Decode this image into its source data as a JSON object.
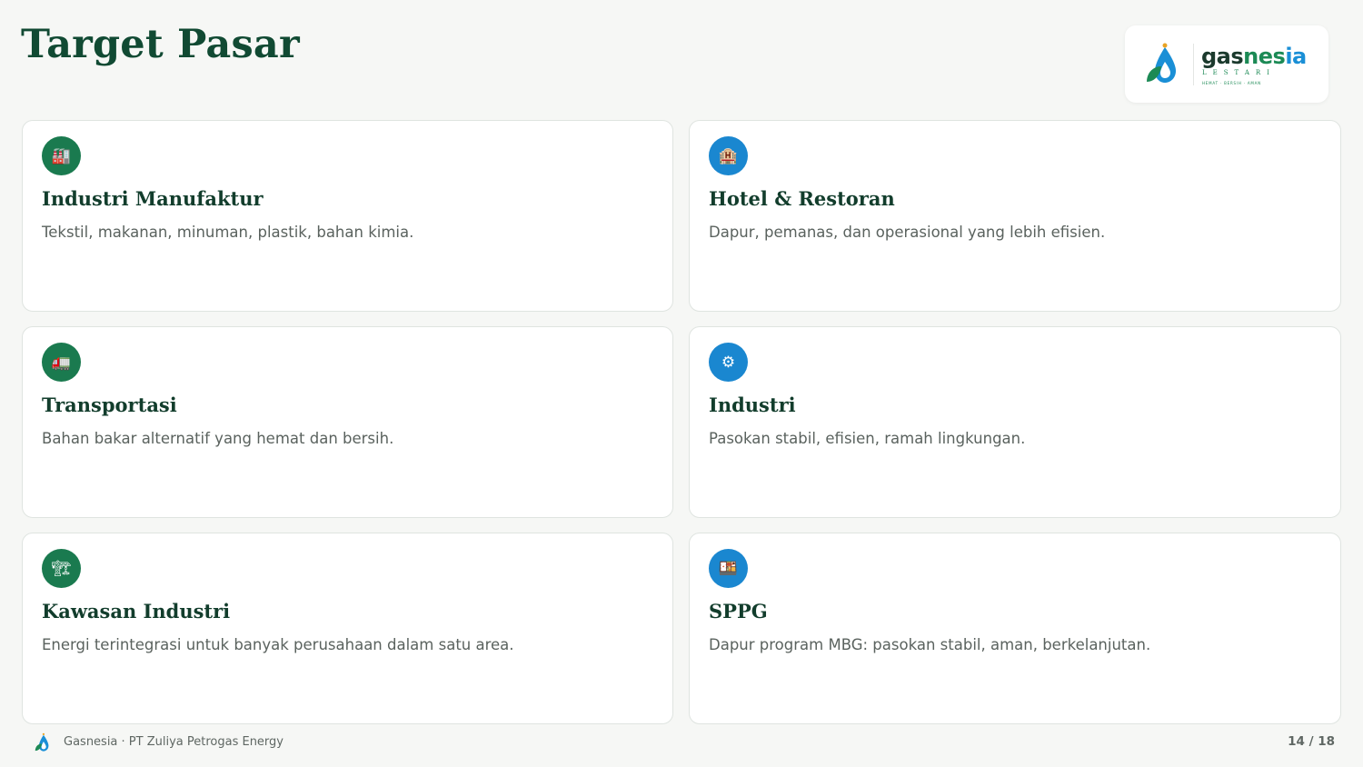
{
  "page": {
    "title": "Target Pasar"
  },
  "logo": {
    "word_gas": "gas",
    "word_nesia": "nes",
    "word_ia": "ia",
    "subtitle": "LESTARI",
    "tagline": "HEMAT · BERSIH · AMAN",
    "icon": "water-drop-leaf-icon",
    "colors": {
      "green": "#1c8a55",
      "blue": "#1a8fd6",
      "dark": "#1b3a2d"
    }
  },
  "cards": [
    {
      "icon": "🏭",
      "icon_name": "factory-icon",
      "color": "green",
      "title": "Industri Manufaktur",
      "desc": "Tekstil, makanan, minuman, plastik, bahan kimia."
    },
    {
      "icon": "🏨",
      "icon_name": "hotel-icon",
      "color": "blue",
      "title": "Hotel & Restoran",
      "desc": "Dapur, pemanas, dan operasional yang lebih efisien."
    },
    {
      "icon": "🚛",
      "icon_name": "truck-icon",
      "color": "green",
      "title": "Transportasi",
      "desc": "Bahan bakar alternatif yang hemat dan bersih."
    },
    {
      "icon": "⚙",
      "icon_name": "gear-icon",
      "color": "blue",
      "title": "Industri",
      "desc": "Pasokan stabil, efisien, ramah lingkungan."
    },
    {
      "icon": "🏗",
      "icon_name": "construction-crane-icon",
      "color": "green",
      "title": "Kawasan Industri",
      "desc": "Energi terintegrasi untuk banyak perusahaan dalam satu area."
    },
    {
      "icon": "🍱",
      "icon_name": "bento-box-icon",
      "color": "blue",
      "title": "SPPG",
      "desc": "Dapur program MBG: pasokan stabil, aman, berkelanjutan."
    }
  ],
  "footer": {
    "text": "Gasnesia · PT Zuliya Petrogas Energy",
    "page": "14 / 18"
  },
  "colors": {
    "title": "#114a33",
    "icon_green": "#1a7a4f",
    "icon_blue": "#1a87d0",
    "background": "#f6f7f5"
  }
}
